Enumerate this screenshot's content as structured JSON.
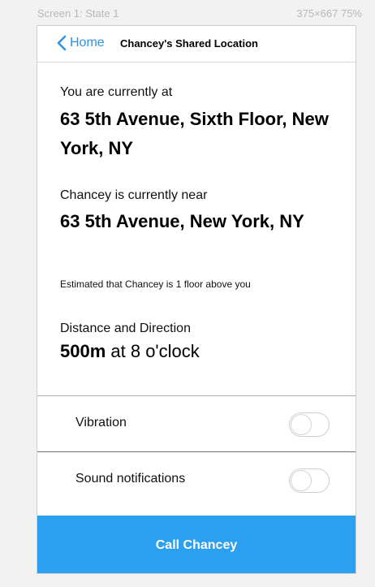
{
  "frame": {
    "caption_left": "Screen 1: State 1",
    "caption_right": "375×667  75%"
  },
  "navbar": {
    "back_label": "Home",
    "title": "Chancey's Shared Location"
  },
  "location": {
    "you_label": "You are currently at",
    "you_address": "63 5th Avenue, Sixth Floor, New York, NY",
    "near_label": "Chancey is currently near",
    "near_address": "63 5th Avenue, New York, NY",
    "estimate": "Estimated that Chancey is 1 floor above you"
  },
  "distance": {
    "label": "Distance and Direction",
    "value": "500m",
    "direction": " at 8 o'clock"
  },
  "settings": {
    "vibration_label": "Vibration",
    "vibration_on": false,
    "sound_label": "Sound notifications",
    "sound_on": false
  },
  "actions": {
    "call_label": "Call Chancey"
  },
  "colors": {
    "accent": "#2f93e8",
    "call_button": "#2b9ff0"
  }
}
